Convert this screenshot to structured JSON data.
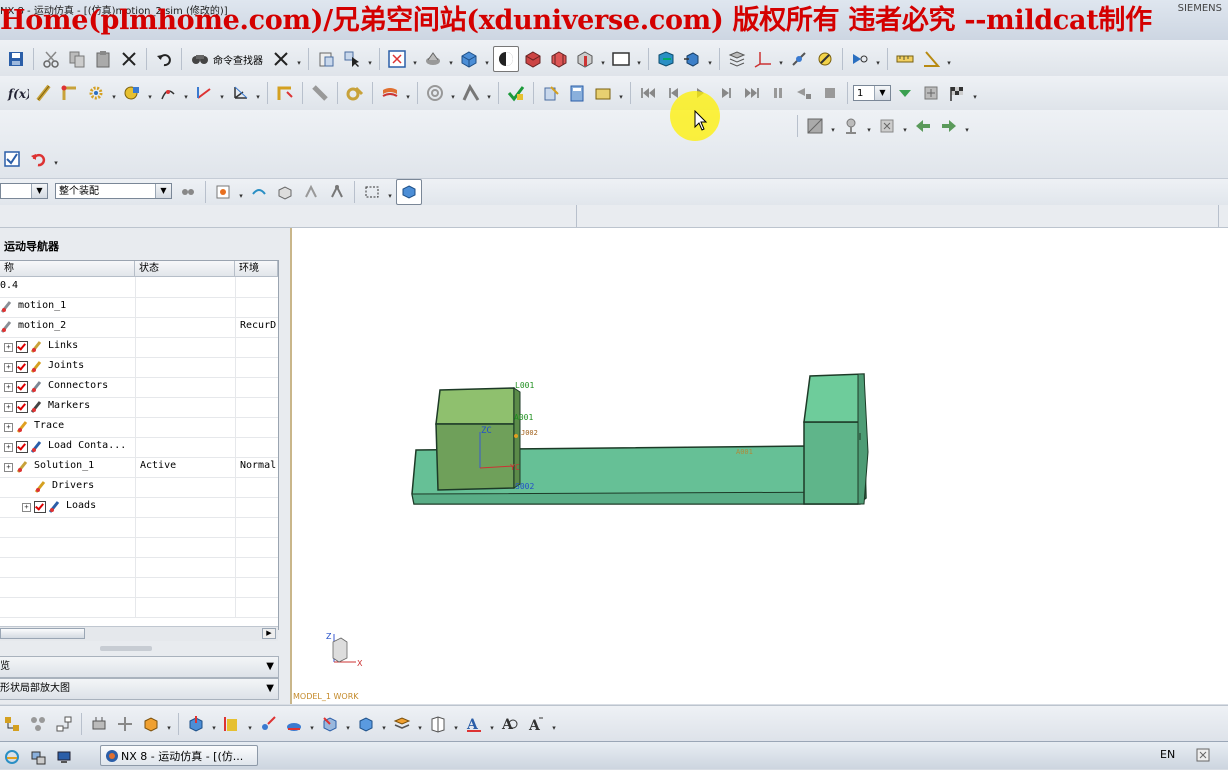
{
  "window": {
    "title_partial": "NX 8 - 运动仿真 - [(仿真)motion_2.sim (修改的)]",
    "watermark": "Home(plmhome.com)/兄弟空间站(xduniverse.com) 版权所有 违者必究 --mildcat制作",
    "corner_text": "SIEMENS"
  },
  "toolbar": {
    "command_finder_label": "命令查找器",
    "frame_combo_value": "1"
  },
  "selection_bar": {
    "filter_value": "",
    "scope_value": "整个装配"
  },
  "navigator": {
    "title": "运动导航器",
    "columns": [
      "称",
      "状态",
      "环境"
    ],
    "rows": [
      {
        "name": "0.4",
        "status": "",
        "env": "",
        "indent": 0,
        "check": false,
        "plus": false,
        "icon": "none"
      },
      {
        "name": "motion_1",
        "status": "",
        "env": "",
        "indent": 0,
        "check": false,
        "plus": false,
        "icon": "sim-icon"
      },
      {
        "name": "motion_2",
        "status": "",
        "env": "RecurD",
        "indent": 0,
        "check": false,
        "plus": false,
        "icon": "sim-icon"
      },
      {
        "name": "Links",
        "status": "",
        "env": "",
        "indent": 1,
        "check": true,
        "plus": true,
        "icon": "link-icon"
      },
      {
        "name": "Joints",
        "status": "",
        "env": "",
        "indent": 1,
        "check": true,
        "plus": true,
        "icon": "joint-icon"
      },
      {
        "name": "Connectors",
        "status": "",
        "env": "",
        "indent": 1,
        "check": true,
        "plus": true,
        "icon": "connector-icon"
      },
      {
        "name": "Markers",
        "status": "",
        "env": "",
        "indent": 1,
        "check": true,
        "plus": true,
        "icon": "marker-icon"
      },
      {
        "name": "Trace",
        "status": "",
        "env": "",
        "indent": 1,
        "check": false,
        "plus": true,
        "icon": "trace-icon"
      },
      {
        "name": "Load Conta...",
        "status": "",
        "env": "",
        "indent": 1,
        "check": true,
        "plus": true,
        "icon": "load-icon"
      },
      {
        "name": "Solution_1",
        "status": "Active",
        "env": "Normal",
        "indent": 1,
        "check": false,
        "plus": true,
        "icon": "solution-icon"
      },
      {
        "name": "Drivers",
        "status": "",
        "env": "",
        "indent": 2,
        "check": false,
        "plus": false,
        "icon": "driver-icon"
      },
      {
        "name": "Loads",
        "status": "",
        "env": "",
        "indent": 2,
        "check": true,
        "plus": true,
        "icon": "load-icon"
      },
      {
        "name": "",
        "status": "",
        "env": "",
        "indent": 0,
        "check": false,
        "plus": false,
        "icon": "none"
      },
      {
        "name": "",
        "status": "",
        "env": "",
        "indent": 0,
        "check": false,
        "plus": false,
        "icon": "none"
      },
      {
        "name": "",
        "status": "",
        "env": "",
        "indent": 0,
        "check": false,
        "plus": false,
        "icon": "none"
      },
      {
        "name": "",
        "status": "",
        "env": "",
        "indent": 0,
        "check": false,
        "plus": false,
        "icon": "none"
      },
      {
        "name": "",
        "status": "",
        "env": "",
        "indent": 0,
        "check": false,
        "plus": false,
        "icon": "none"
      }
    ],
    "panel1_label": "览",
    "panel2_label": "形状局部放大图"
  },
  "viewport": {
    "work_label": "MODEL_1 WORK",
    "labels": {
      "l001": "L001",
      "a001": "A001",
      "j002": "J002",
      "zc": "ZC",
      "yc": "YC",
      "s002": "S002",
      "a001b": "A001"
    },
    "triad": {
      "z": "Z",
      "x": "X"
    },
    "colors": {
      "block_light": "#86b86b",
      "block_dark": "#5e9a52",
      "base": "#66c096",
      "edge": "#1d3a27"
    }
  },
  "taskbar": {
    "item_label": "NX 8 - 运动仿真 - [(仿...",
    "lang": "EN"
  }
}
